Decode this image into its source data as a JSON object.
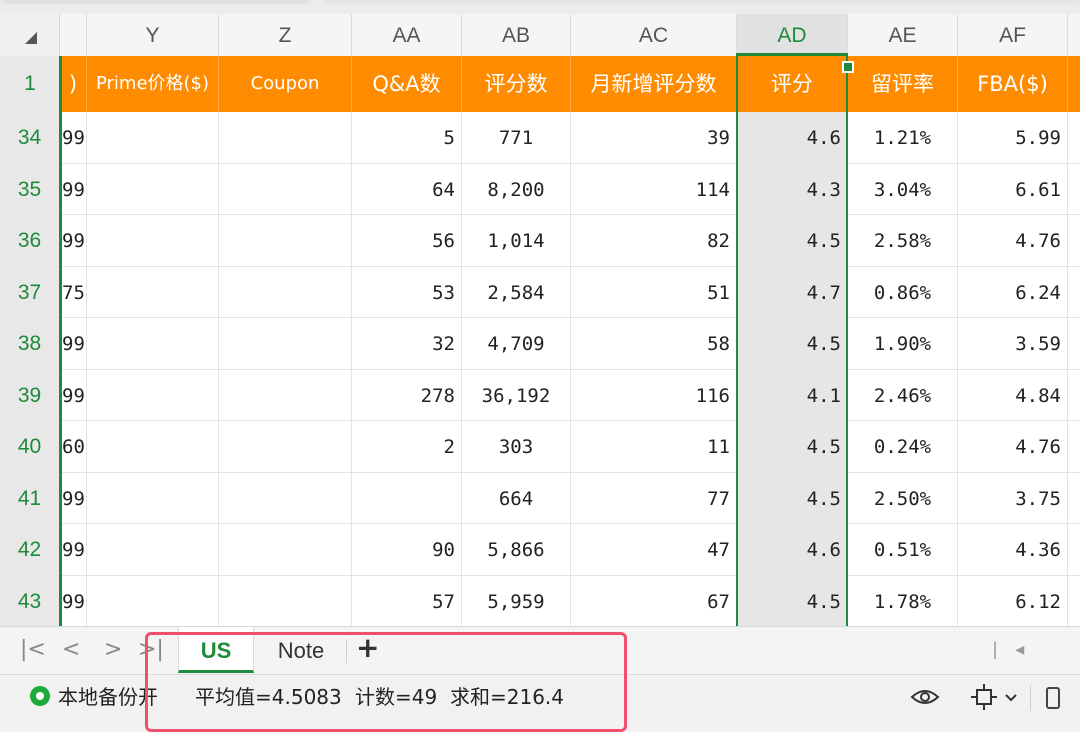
{
  "columns": [
    "Y",
    "Z",
    "AA",
    "AB",
    "AC",
    "AD",
    "AE",
    "AF"
  ],
  "active_column": "AD",
  "header_row_number": "1",
  "header_partial": ")",
  "headers": [
    "Prime价格($)",
    "Coupon",
    "Q&A数",
    "评分数",
    "月新增评分数",
    "评分",
    "留评率",
    "FBA($)"
  ],
  "rows": [
    {
      "num": "34",
      "x": "99",
      "y": "",
      "z": "",
      "aa": "5",
      "ab": "771",
      "ac": "39",
      "ad": "4.6",
      "ae": "1.21%",
      "af": "5.99"
    },
    {
      "num": "35",
      "x": "99",
      "y": "",
      "z": "",
      "aa": "64",
      "ab": "8,200",
      "ac": "114",
      "ad": "4.3",
      "ae": "3.04%",
      "af": "6.61"
    },
    {
      "num": "36",
      "x": "99",
      "y": "",
      "z": "",
      "aa": "56",
      "ab": "1,014",
      "ac": "82",
      "ad": "4.5",
      "ae": "2.58%",
      "af": "4.76"
    },
    {
      "num": "37",
      "x": "75",
      "y": "",
      "z": "",
      "aa": "53",
      "ab": "2,584",
      "ac": "51",
      "ad": "4.7",
      "ae": "0.86%",
      "af": "6.24"
    },
    {
      "num": "38",
      "x": "99",
      "y": "",
      "z": "",
      "aa": "32",
      "ab": "4,709",
      "ac": "58",
      "ad": "4.5",
      "ae": "1.90%",
      "af": "3.59"
    },
    {
      "num": "39",
      "x": "99",
      "y": "",
      "z": "",
      "aa": "278",
      "ab": "36,192",
      "ac": "116",
      "ad": "4.1",
      "ae": "2.46%",
      "af": "4.84"
    },
    {
      "num": "40",
      "x": "60",
      "y": "",
      "z": "",
      "aa": "2",
      "ab": "303",
      "ac": "11",
      "ad": "4.5",
      "ae": "0.24%",
      "af": "4.76"
    },
    {
      "num": "41",
      "x": "99",
      "y": "",
      "z": "",
      "aa": "",
      "ab": "664",
      "ac": "77",
      "ad": "4.5",
      "ae": "2.50%",
      "af": "3.75"
    },
    {
      "num": "42",
      "x": "99",
      "y": "",
      "z": "",
      "aa": "90",
      "ab": "5,866",
      "ac": "47",
      "ad": "4.6",
      "ae": "0.51%",
      "af": "4.36"
    },
    {
      "num": "43",
      "x": "99",
      "y": "",
      "z": "",
      "aa": "57",
      "ab": "5,959",
      "ac": "67",
      "ad": "4.5",
      "ae": "1.78%",
      "af": "6.12"
    }
  ],
  "sheets": {
    "active": "US",
    "other": "Note",
    "add": "+"
  },
  "nav": {
    "first": "|<",
    "prev": "<",
    "next": ">",
    "last": ">|"
  },
  "status": {
    "backup": "本地备份开",
    "average": "平均值=4.5083",
    "count": "计数=49",
    "sum": "求和=216.4"
  },
  "colors": {
    "header_bg": "#ff8c00",
    "accent": "#1e8a3a",
    "highlight": "#f0506e"
  },
  "icons": [
    "select-all-icon",
    "fill-handle-icon",
    "eye-icon",
    "fit-view-icon",
    "panel-icon"
  ]
}
